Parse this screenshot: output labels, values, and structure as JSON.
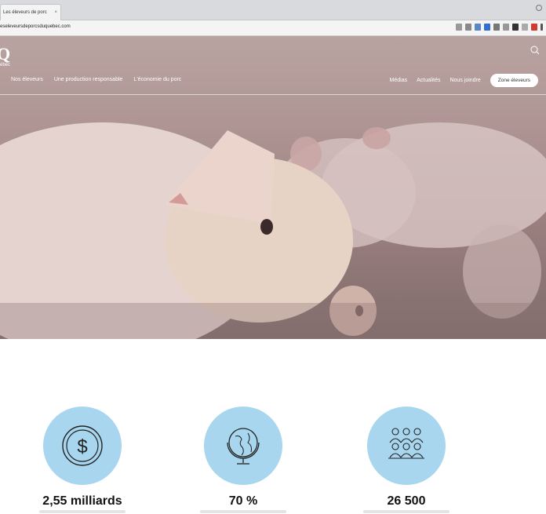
{
  "browser": {
    "tab_title": "Les éleveurs de porc",
    "tab_close": "×",
    "url": "eseleveursdeporcsduquebec.com",
    "extensions": [
      "star-icon",
      "square-icon",
      "extension-icon",
      "blue-icon",
      "puzzle-icon",
      "doc-icon",
      "dark-icon",
      "grid-icon",
      "red-icon",
      "menu-icon"
    ]
  },
  "site": {
    "logo_text": "ébec",
    "nav_left": [
      "Nos éleveurs",
      "Une production responsable",
      "L'économie du porc"
    ],
    "nav_right": [
      "Médias",
      "Actualités",
      "Nous joindre"
    ],
    "zone_button": "Zone éleveurs"
  },
  "stats": [
    {
      "icon": "dollar-coin-icon",
      "value": "2,55 milliards"
    },
    {
      "icon": "globe-icon",
      "value": "70 %"
    },
    {
      "icon": "people-group-icon",
      "value": "26 500"
    }
  ],
  "colors": {
    "stat_circle": "#a8d6ef",
    "hero_tint": "#ae9593"
  }
}
